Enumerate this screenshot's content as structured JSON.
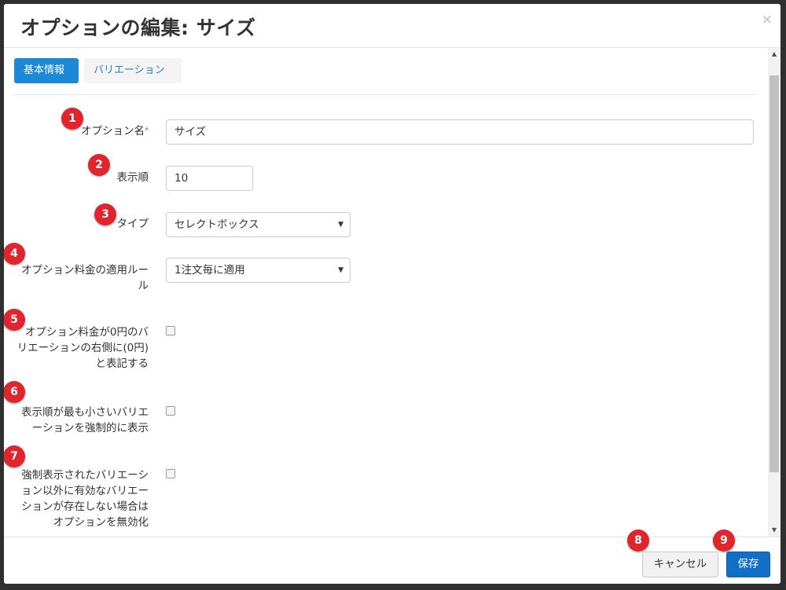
{
  "modal": {
    "title": "オプションの編集: サイズ",
    "close_glyph": "×"
  },
  "tabs": [
    {
      "label": "基本情報",
      "active": true
    },
    {
      "label": "バリエーション",
      "active": false
    }
  ],
  "form": {
    "option_name": {
      "label": "オプション名",
      "required_mark": "*",
      "value": "サイズ"
    },
    "display_order": {
      "label": "表示順",
      "value": "10"
    },
    "type": {
      "label": "タイプ",
      "value": "セレクトボックス"
    },
    "price_rule": {
      "label_lines": [
        "オプション料金の適用ルー",
        "ル"
      ],
      "value": "1注文毎に適用"
    },
    "zero_price_label": {
      "label_lines": [
        "オプション料金が0円のバ",
        "リエーションの右側に(0円)",
        "と表記する"
      ],
      "checked": false
    },
    "force_min_order": {
      "label_lines": [
        "表示順が最も小さいバリエ",
        "ーションを強制的に表示"
      ],
      "checked": false
    },
    "disable_if_none": {
      "label_lines": [
        "強制表示されたバリエーシ",
        "ョン以外に有効なバリエー",
        "ションが存在しない場合は",
        "オプションを無効化"
      ],
      "checked": false
    }
  },
  "badges": [
    "1",
    "2",
    "3",
    "4",
    "5",
    "6",
    "7",
    "8",
    "9"
  ],
  "footer": {
    "cancel_label": "キャンセル",
    "save_label": "保存"
  },
  "colors": {
    "accent": "#1c88d6",
    "save_button": "#1170c6",
    "badge": "#e0252d",
    "required": "#d9534f"
  }
}
